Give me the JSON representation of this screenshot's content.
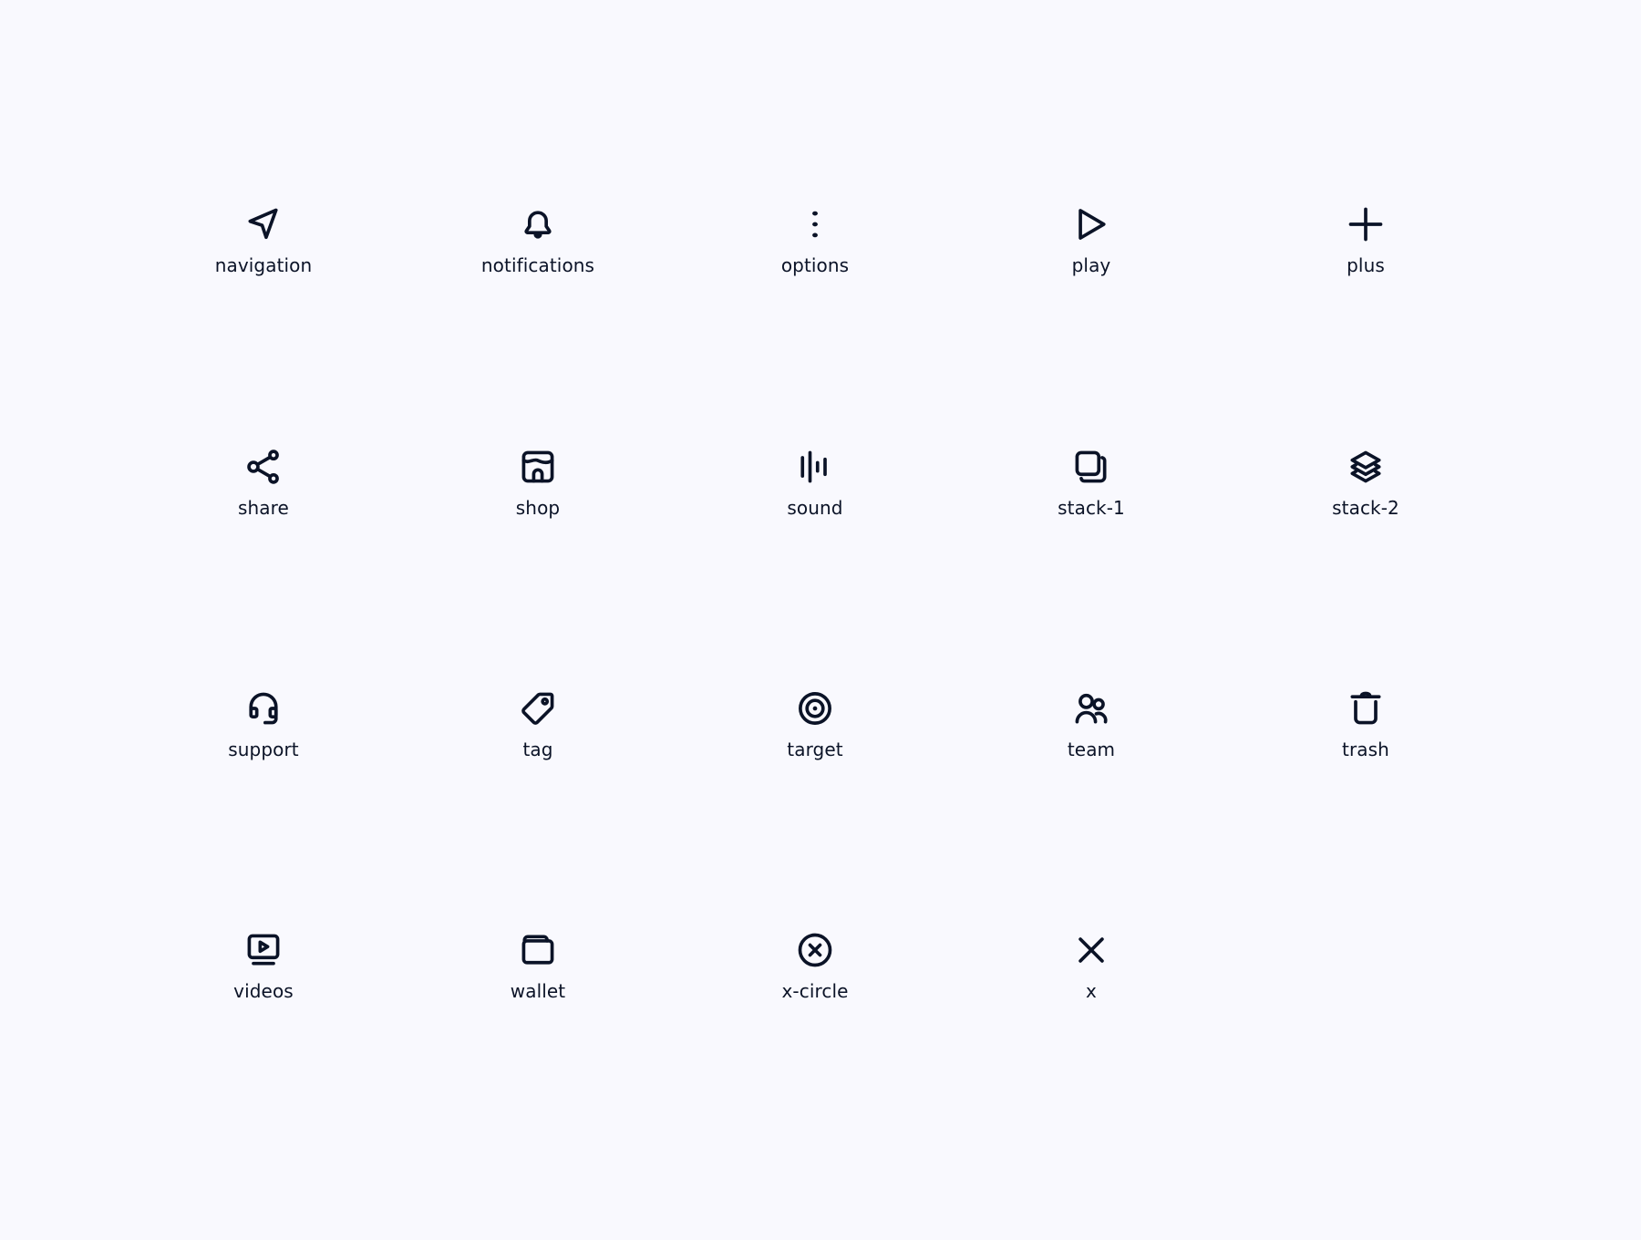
{
  "colors": {
    "background": "#f9f9fe",
    "icon": "#0b1327",
    "text": "#0b1327"
  },
  "icons": [
    {
      "name": "navigation",
      "label": "navigation",
      "icon": "navigation-icon"
    },
    {
      "name": "notifications",
      "label": "notifications",
      "icon": "bell-icon"
    },
    {
      "name": "options",
      "label": "options",
      "icon": "more-vertical-icon"
    },
    {
      "name": "play",
      "label": "play",
      "icon": "play-icon"
    },
    {
      "name": "plus",
      "label": "plus",
      "icon": "plus-icon"
    },
    {
      "name": "share",
      "label": "share",
      "icon": "share-icon"
    },
    {
      "name": "shop",
      "label": "shop",
      "icon": "store-icon"
    },
    {
      "name": "sound",
      "label": "sound",
      "icon": "sound-wave-icon"
    },
    {
      "name": "stack-1",
      "label": "stack-1",
      "icon": "copy-stack-icon"
    },
    {
      "name": "stack-2",
      "label": "stack-2",
      "icon": "layers-icon"
    },
    {
      "name": "support",
      "label": "support",
      "icon": "headset-icon"
    },
    {
      "name": "tag",
      "label": "tag",
      "icon": "tag-icon"
    },
    {
      "name": "target",
      "label": "target",
      "icon": "target-icon"
    },
    {
      "name": "team",
      "label": "team",
      "icon": "users-icon"
    },
    {
      "name": "trash",
      "label": "trash",
      "icon": "trash-icon"
    },
    {
      "name": "videos",
      "label": "videos",
      "icon": "video-monitor-icon"
    },
    {
      "name": "wallet",
      "label": "wallet",
      "icon": "wallet-icon"
    },
    {
      "name": "x-circle",
      "label": "x-circle",
      "icon": "x-circle-icon"
    },
    {
      "name": "x",
      "label": "x",
      "icon": "x-icon"
    }
  ]
}
